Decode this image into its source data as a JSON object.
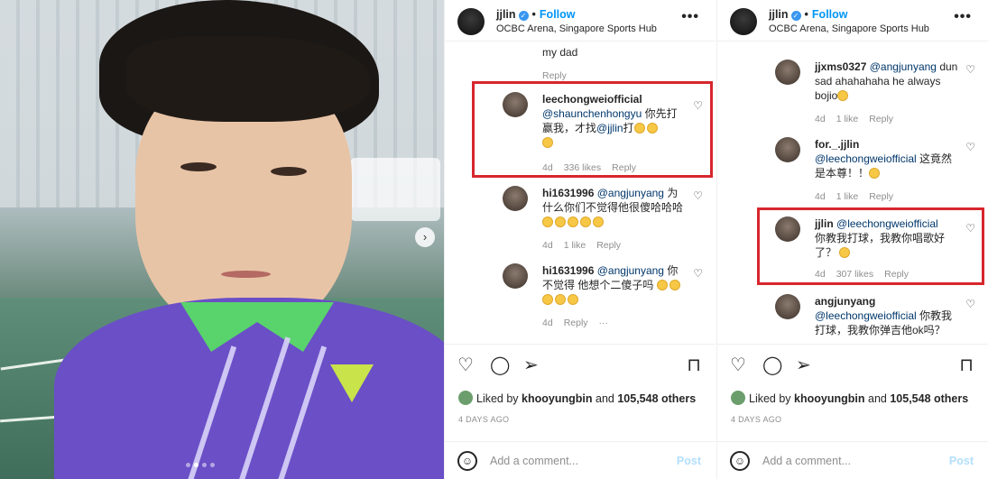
{
  "post": {
    "username": "jjlin",
    "follow_label": "Follow",
    "location": "OCBC Arena, Singapore Sports Hub",
    "more_label": "•••",
    "liked_by_prefix": "Liked by",
    "liked_by_user": "khooyungbin",
    "liked_by_and": "and",
    "liked_by_count": "105,548 others",
    "date": "4 DAYS AGO",
    "add_comment_placeholder": "Add a comment...",
    "post_label": "Post"
  },
  "panel1": {
    "top_fragment": "my dad",
    "top_fragment_reply": "Reply",
    "comments": [
      {
        "user": "leechongweiofficial",
        "mention": "@shaunchenhongyu",
        "text_a": "你先打赢我，才找",
        "mention2": "@jjlin",
        "text_b": "打",
        "age": "4d",
        "likes": "336 likes",
        "reply": "Reply"
      },
      {
        "user": "hi1631996",
        "mention": "@angjunyang",
        "text": "为什么你们不觉得他很傻哈哈哈",
        "age": "4d",
        "likes": "1 like",
        "reply": "Reply"
      },
      {
        "user": "hi1631996",
        "mention": "@angjunyang",
        "text": "你不觉得 他想个二傻子吗",
        "age": "4d",
        "reply": "Reply",
        "more": "···"
      }
    ]
  },
  "panel2": {
    "comments": [
      {
        "user": "jjxms0327",
        "mention": "@angjunyang",
        "text": "dun sad ahahahaha he always bojio",
        "age": "4d",
        "likes": "1 like",
        "reply": "Reply"
      },
      {
        "user": "for._.jjlin",
        "mention": "@leechongweiofficial",
        "text": "这竟然是本尊！！",
        "age": "4d",
        "likes": "1 like",
        "reply": "Reply"
      },
      {
        "user": "jjlin",
        "mention": "@leechongweiofficial",
        "text": "你教我打球，我教你唱歌好了？",
        "age": "4d",
        "likes": "307 likes",
        "reply": "Reply"
      },
      {
        "user": "angjunyang",
        "mention": "@leechongweiofficial",
        "text": "你教我打球，我教你弹吉他ok吗？"
      }
    ]
  },
  "icons": {
    "heart": "♡",
    "comment": "◯",
    "share": "➢",
    "save": "⊓",
    "next": "›",
    "verified": "✓"
  },
  "colors": {
    "accent": "#0095f6",
    "highlight": "#d7262d",
    "muted": "#8e8e8e"
  }
}
